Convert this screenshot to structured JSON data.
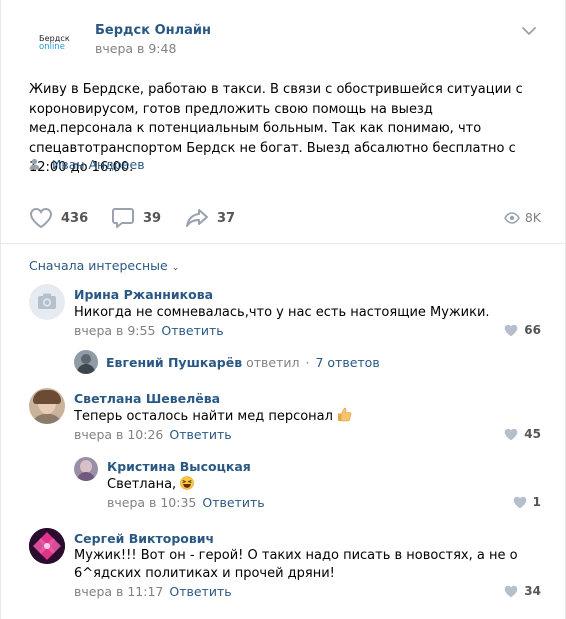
{
  "post": {
    "logo_line1": "Бердск",
    "logo_line2": "online",
    "author": "Бердск Онлайн",
    "time": "вчера в 9:48",
    "text": "Живу в Бердске, работаю в такси. В связи с обострившейся ситуации с короновирусом, готов предложить свою помощь на выезд мед.персонала к потенциальным больным. Так как понимаю, что спецавтотранспортом Бердск не богат. Выезд абсалютно бесплатно с 12:00 до 16:00.",
    "signer": "Иван Андреев",
    "likes": "436",
    "comments": "39",
    "shares": "37",
    "views": "8K"
  },
  "comments_sort": "Сначала интересные",
  "reply_label": "Ответить",
  "comments": [
    {
      "name": "Ирина Ржанникова",
      "text": "Никогда не сомневалась,что у нас есть настоящие Мужики.",
      "time": "вчера в 9:55",
      "likes": "66"
    },
    {
      "name": "Светлана Шевелёва",
      "text": "Теперь осталось найти мед персонал",
      "time": "вчера в 10:26",
      "likes": "45"
    },
    {
      "name": "Кристина Высоцкая",
      "text": "Светлана,",
      "time": "вчера в 10:35",
      "likes": "1"
    },
    {
      "name": "Сергей Викторович",
      "text": "Мужик!!! Вот он - герой! О таких надо писать в новостях, а не о 6^ядских политиках и прочей дряни!",
      "time": "вчера в 11:17",
      "likes": "34"
    }
  ],
  "thread": {
    "name": "Евгений Пушкарёв",
    "verb": "ответил",
    "dot": "·",
    "count": "7 ответов"
  },
  "colors": {
    "link": "#2a5885",
    "meta": "#828282",
    "icon": "#99a2ad"
  }
}
